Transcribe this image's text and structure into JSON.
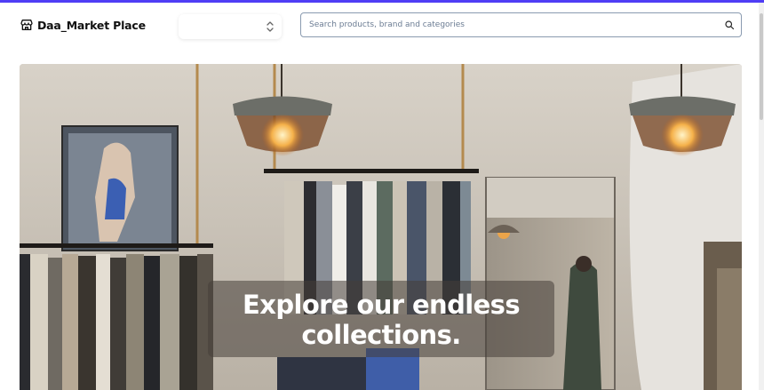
{
  "header": {
    "brand_name": "Daa_Market Place",
    "brand_icon": "store-icon",
    "select": {
      "value": "",
      "icon": "chevron-updown-icon"
    },
    "search": {
      "placeholder": "Search products, brand and categories",
      "value": "",
      "icon": "search-icon"
    }
  },
  "hero": {
    "image": "clothing-store-interior",
    "headline": "Explore our endless collections."
  },
  "colors": {
    "accent": "#4f3df5",
    "search_border": "#8a9bb0",
    "text_dark": "#111111"
  }
}
